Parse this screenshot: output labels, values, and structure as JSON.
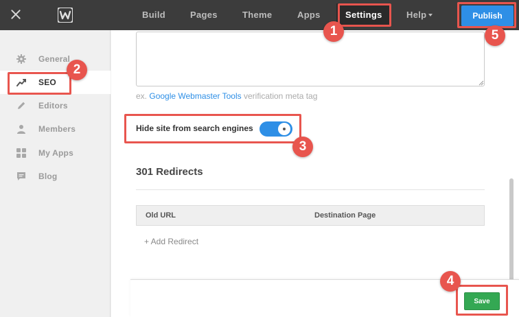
{
  "topbar": {
    "nav": [
      {
        "label": "Build"
      },
      {
        "label": "Pages"
      },
      {
        "label": "Theme"
      },
      {
        "label": "Apps"
      },
      {
        "label": "Settings"
      },
      {
        "label": "Help"
      }
    ],
    "active_nav": "Settings",
    "publish_label": "Publish",
    "icons": {
      "close": "close-icon",
      "logo": "weebly-logo-icon",
      "help_caret": "caret-down-icon"
    }
  },
  "sidebar": {
    "items": [
      {
        "label": "General",
        "icon": "gear-icon"
      },
      {
        "label": "SEO",
        "icon": "trend-chart-icon"
      },
      {
        "label": "Editors",
        "icon": "pencil-icon"
      },
      {
        "label": "Members",
        "icon": "person-icon"
      },
      {
        "label": "My Apps",
        "icon": "grid-icon"
      },
      {
        "label": "Blog",
        "icon": "speech-bubble-icon"
      }
    ],
    "active_item": "SEO"
  },
  "main": {
    "meta_textarea_value": "",
    "hint_prefix": "ex.",
    "hint_link": "Google Webmaster Tools",
    "hint_suffix": "verification meta tag",
    "toggle_label": "Hide site from search engines",
    "toggle_fraction_on": 1,
    "redirects_title": "301 Redirects",
    "table_headers": [
      "Old URL",
      "Destination Page"
    ],
    "add_redirect_label": "+ Add Redirect"
  },
  "savebar": {
    "save_label": "Save"
  },
  "annotations": {
    "color": "#e8554e",
    "steps": [
      "1",
      "2",
      "3",
      "4",
      "5"
    ]
  },
  "colors": {
    "accent": "#2e8fe6",
    "save_green": "#34a853",
    "topbar": "#3c3c3c"
  }
}
